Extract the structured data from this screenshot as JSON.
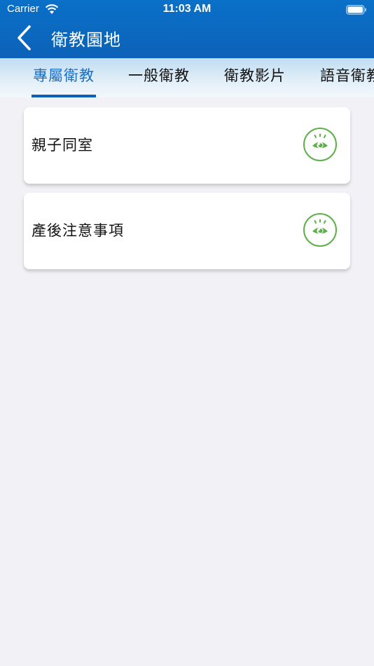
{
  "status_bar": {
    "carrier": "Carrier",
    "time": "11:03 AM"
  },
  "nav": {
    "title": "衛教園地"
  },
  "tabs": [
    {
      "label": "專屬衛教",
      "active": true
    },
    {
      "label": "一般衛教",
      "active": false
    },
    {
      "label": "衛教影片",
      "active": false
    },
    {
      "label": "語音衛教",
      "active": false
    }
  ],
  "items": [
    {
      "title": "親子同室",
      "action_icon": "eye-icon"
    },
    {
      "title": "產後注意事項",
      "action_icon": "eye-icon"
    }
  ],
  "colors": {
    "header": "#0c62b8",
    "active_tab": "#1a6fc5",
    "icon_green": "#5fb04a",
    "background": "#f1f1f6"
  }
}
